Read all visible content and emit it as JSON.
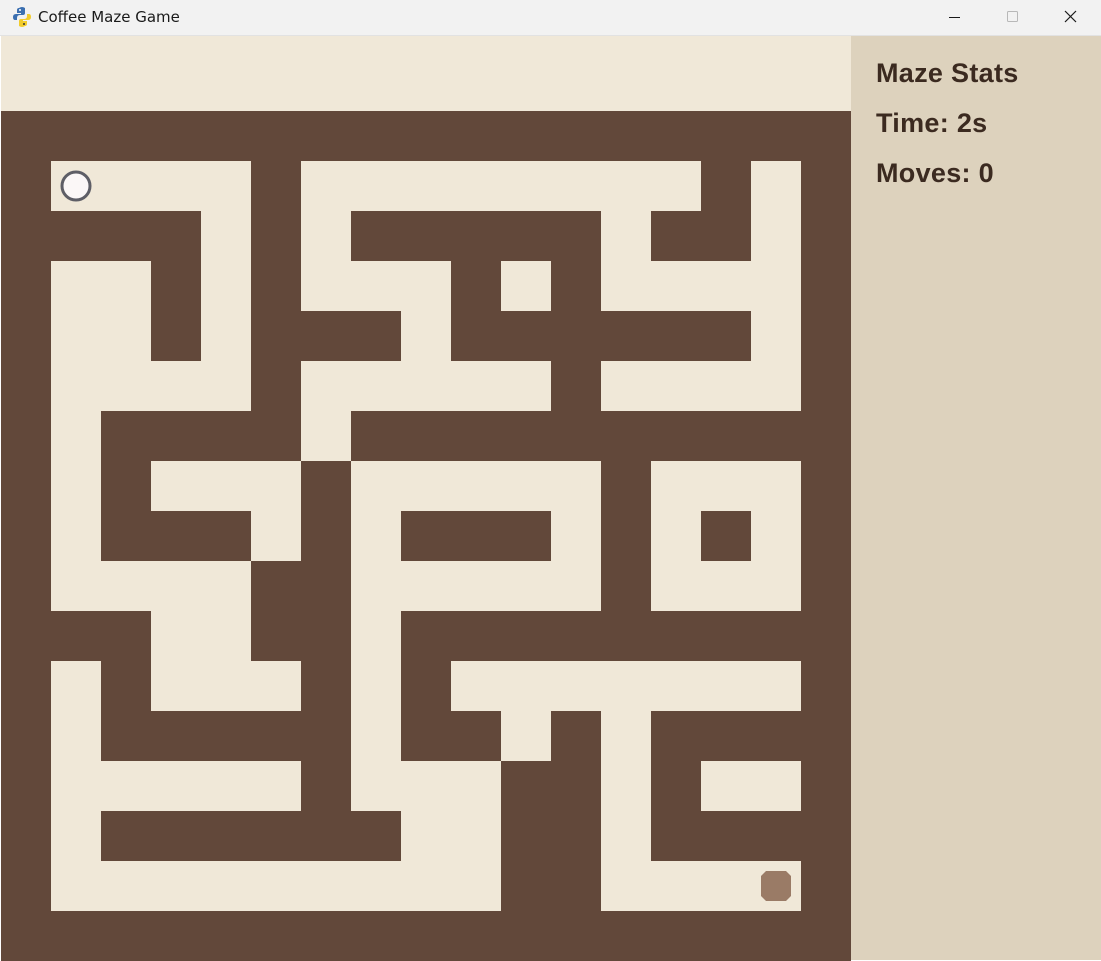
{
  "window": {
    "title": "Coffee Maze Game",
    "app_icon": "python-snake-icon",
    "controls": [
      "minimize-icon",
      "maximize-icon",
      "close-icon"
    ]
  },
  "colors": {
    "wall": "#62483a",
    "path": "#f0e8d8",
    "sidebar": "#ddd2bd",
    "stats_text": "#3b2a20",
    "player_fill": "#fbf7f7",
    "player_outline": "#5e5e66",
    "goal": "#9a7b66"
  },
  "sidebar": {
    "title": "Maze Stats",
    "time": "Time: 2s",
    "moves": "Moves: 0"
  },
  "maze": {
    "rows": [
      "11111111111111111",
      "10000100000000101",
      "11110101111101101",
      "10010100010100001",
      "10010111011111101",
      "10000100000100001",
      "10111101111111111",
      "10100010000010001",
      "10111010111010101",
      "10000110000010001",
      "11100110111111111",
      "10100010100000001",
      "10111110110101111",
      "10000010001101001",
      "10111111001101111",
      "10000000001100001",
      "11111111111111111"
    ],
    "player": {
      "row": 1,
      "col": 1
    },
    "goal": {
      "row": 15,
      "col": 15
    }
  }
}
